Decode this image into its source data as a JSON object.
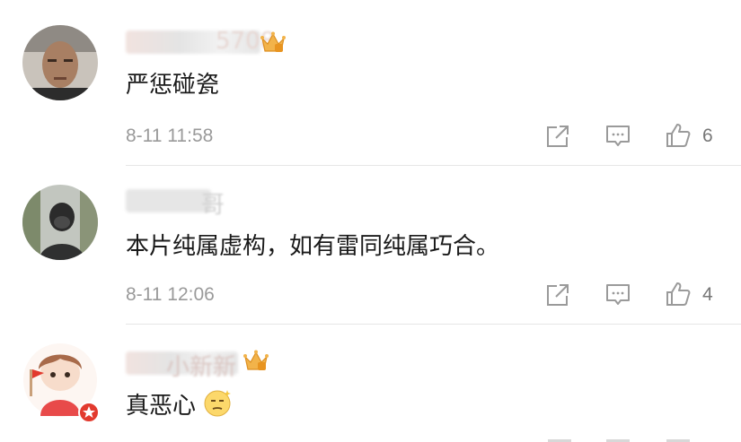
{
  "colors": {
    "text": "#1a1a1a",
    "meta": "#9a9a9a",
    "icon": "#9a9a9a",
    "crown": "#f0a93c",
    "badge_red": "#e23a2e"
  },
  "comments": [
    {
      "username": "",
      "username_suffix_visible": "5708",
      "has_crown_badge": true,
      "text": "严惩碰瓷",
      "time": "8-11 11:58",
      "like_count": "6",
      "avatar": "man-photo-avatar"
    },
    {
      "username": "",
      "username_suffix_visible": "哥",
      "has_crown_badge": false,
      "text": "本片纯属虚构，如有雷同纯属巧合。",
      "time": "8-11 12:06",
      "like_count": "4",
      "avatar": "masked-person-photo-avatar"
    },
    {
      "username": "",
      "username_suffix_visible": "小新新",
      "has_crown_badge": true,
      "text": "真恶心",
      "time": "",
      "like_count": "",
      "avatar": "cartoon-boy-avatar",
      "emoji": "smirk-emoji"
    }
  ]
}
